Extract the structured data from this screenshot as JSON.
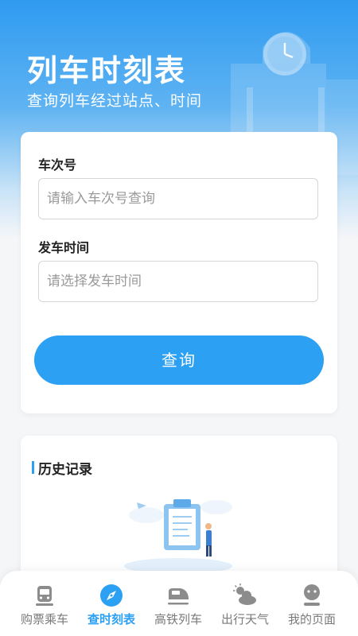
{
  "header": {
    "title": "列车时刻表",
    "subtitle": "查询列车经过站点、时间"
  },
  "form": {
    "train_number_label": "车次号",
    "train_number_placeholder": "请输入车次号查询",
    "departure_time_label": "发车时间",
    "departure_time_placeholder": "请选择发车时间",
    "query_button": "查询"
  },
  "history": {
    "title": "历史记录"
  },
  "tabbar": {
    "items": [
      {
        "label": "购票乘车",
        "icon": "train-icon"
      },
      {
        "label": "查时刻表",
        "icon": "compass-icon"
      },
      {
        "label": "高铁列车",
        "icon": "high-speed-train-icon"
      },
      {
        "label": "出行天气",
        "icon": "weather-icon"
      },
      {
        "label": "我的页面",
        "icon": "profile-icon"
      }
    ],
    "active_index": 1
  },
  "colors": {
    "accent": "#2ca0f2",
    "header_top": "#2f9bf0",
    "inactive_tab": "#7a7a7a"
  }
}
